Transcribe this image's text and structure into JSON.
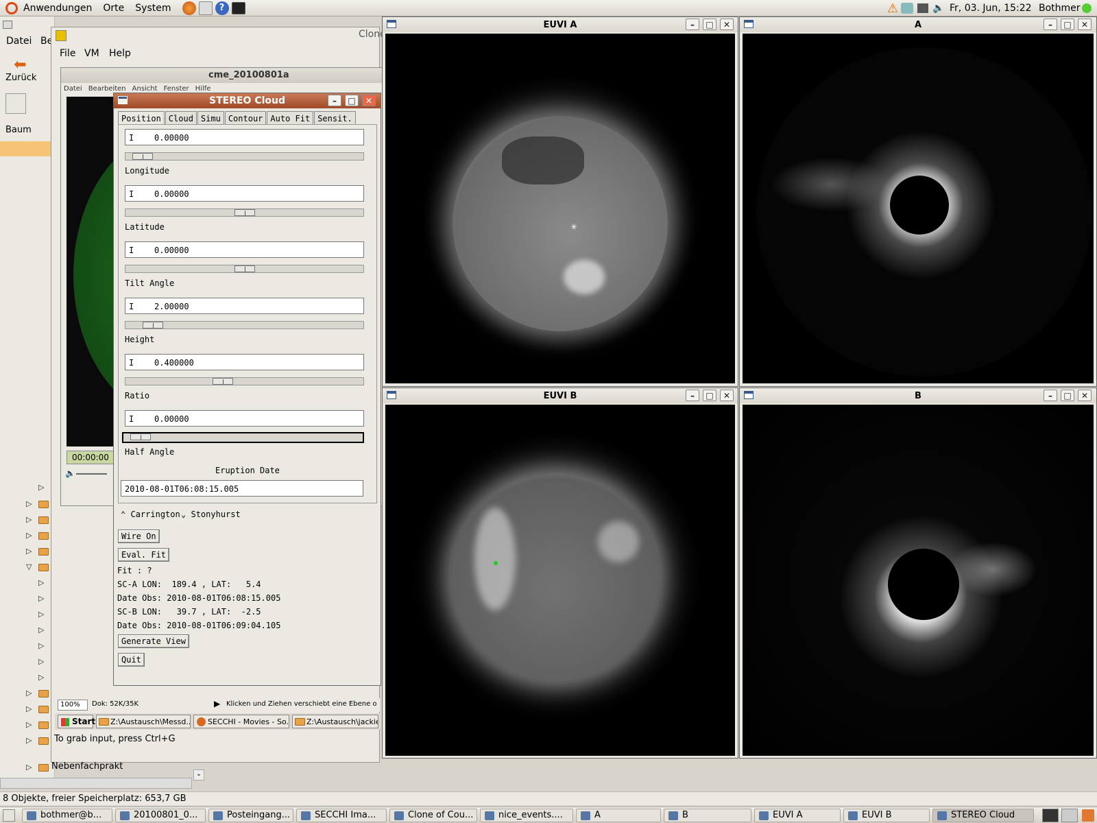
{
  "top_panel": {
    "menus": [
      "Anwendungen",
      "Orte",
      "System"
    ],
    "clock": "Fr, 03. Jun, 15:22",
    "user": "Bothmer"
  },
  "nautilus": {
    "menu_datei": "Datei",
    "menu_be": "Be",
    "back_label": "Zurück",
    "view_mode": "Baum",
    "folder_last": "Nebenfachprakt",
    "status": "8 Objekte, freier Speicherplatz: 653,7 GB"
  },
  "clone_window": {
    "title": "Clone",
    "menu": [
      "File",
      "VM",
      "Help"
    ],
    "grab_hint": "To grab input, press Ctrl+G"
  },
  "inner_window": {
    "title": "cme_20100801a",
    "menu": [
      "Datei",
      "Bearbeiten",
      "Ansicht",
      "Fenster",
      "Hilfe"
    ],
    "timecode": "00:00:00",
    "zoom": "100%",
    "doc_size": "Dok: 52K/35K",
    "hint": "Klicken und Ziehen verschiebt eine Ebene oder Ausw",
    "taskbar": [
      "Start",
      "Z:\\Austausch\\Messd...",
      "SECCHI - Movies - So...",
      "Z:\\Austausch\\jackie_"
    ]
  },
  "stereo_cloud": {
    "title": "STEREO Cloud",
    "tabs": [
      "Position",
      "Cloud",
      "Simu",
      "Contour",
      "Auto Fit",
      "Sensit."
    ],
    "params": [
      {
        "value": "0.00000",
        "label": "Longitude",
        "slider": 0.03
      },
      {
        "value": "0.00000",
        "label": "Latitude",
        "slider": 0.5
      },
      {
        "value": "0.00000",
        "label": "Tilt Angle",
        "slider": 0.5
      },
      {
        "value": "2.00000",
        "label": "Height",
        "slider": 0.08
      },
      {
        "value": "0.400000",
        "label": "Ratio",
        "slider": 0.4
      },
      {
        "value": "0.00000",
        "label": "Half Angle",
        "slider": 0.03
      }
    ],
    "eruption_label": "Eruption Date",
    "eruption_value": "2010-08-01T06:08:15.005",
    "radio_carrington": "Carrington",
    "radio_stonyhurst": "Stonyhurst",
    "wire_button": "Wire On",
    "eval_button": "Eval. Fit",
    "fit_line": "Fit : ?",
    "sca_line": "SC-A LON:  189.4 , LAT:   5.4",
    "sca_date": "Date Obs: 2010-08-01T06:08:15.005",
    "scb_line": "SC-B LON:   39.7 , LAT:  -2.5",
    "scb_date": "Date Obs: 2010-08-01T06:09:04.105",
    "generate_button": "Generate View",
    "quit_button": "Quit"
  },
  "image_windows": [
    {
      "title": "EUVI A"
    },
    {
      "title": "A"
    },
    {
      "title": "EUVI B"
    },
    {
      "title": "B"
    }
  ],
  "taskbar": {
    "items": [
      "bothmer@b...",
      "20100801_0...",
      "Posteingang...",
      "SECCHI Ima...",
      "Clone of Cou...",
      "nice_events....",
      "A",
      "B",
      "EUVI A",
      "EUVI B",
      "STEREO Cloud"
    ]
  }
}
